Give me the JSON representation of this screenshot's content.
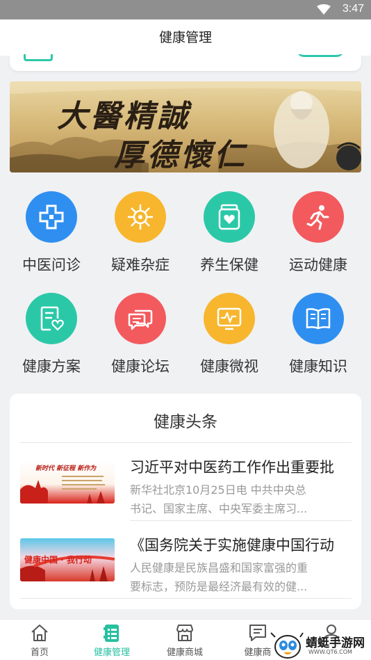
{
  "status_bar": {
    "time": "3:47"
  },
  "header": {
    "title": "健康管理"
  },
  "banner": {
    "line1": "大醫精誠",
    "line2": "厚德懷仁"
  },
  "categories": [
    {
      "label": "中医问诊",
      "icon": "medical-cross-icon",
      "color": "#2f8ff0"
    },
    {
      "label": "疑难杂症",
      "icon": "virus-icon",
      "color": "#f7b62e"
    },
    {
      "label": "养生保健",
      "icon": "health-jar-icon",
      "color": "#2bc8a8"
    },
    {
      "label": "运动健康",
      "icon": "running-person-icon",
      "color": "#f25a5e"
    },
    {
      "label": "健康方案",
      "icon": "health-plan-icon",
      "color": "#2bc8a8"
    },
    {
      "label": "健康论坛",
      "icon": "chat-bubbles-icon",
      "color": "#f25a5e"
    },
    {
      "label": "健康微视",
      "icon": "video-monitor-icon",
      "color": "#f7b62e"
    },
    {
      "label": "健康知识",
      "icon": "book-icon",
      "color": "#2f8ff0"
    }
  ],
  "news": {
    "title": "健康头条",
    "items": [
      {
        "headline": "习近平对中医药工作作出重要批",
        "desc_line1": "新华社北京10月25日电  中共中央总",
        "desc_line2": "书记、国家主席、中央军委主席习...",
        "thumb_text": "新时代  新征程  新作为"
      },
      {
        "headline": "《国务院关于实施健康中国行动",
        "desc_line1": "人民健康是民族昌盛和国家富强的重",
        "desc_line2": "要标志，预防是最经济最有效的健...",
        "thumb_text": "健康中国 · 我行动"
      }
    ]
  },
  "tabbar": {
    "items": [
      {
        "label": "首页",
        "icon": "home-icon"
      },
      {
        "label": "健康管理",
        "icon": "health-management-icon",
        "active": true
      },
      {
        "label": "健康商城",
        "icon": "store-icon"
      },
      {
        "label": "健康商",
        "icon": "message-icon"
      },
      {
        "label": "",
        "icon": "profile-icon"
      }
    ]
  },
  "watermark": {
    "name": "蜻蜓手游网",
    "url": "WWW.QT6.COM"
  }
}
